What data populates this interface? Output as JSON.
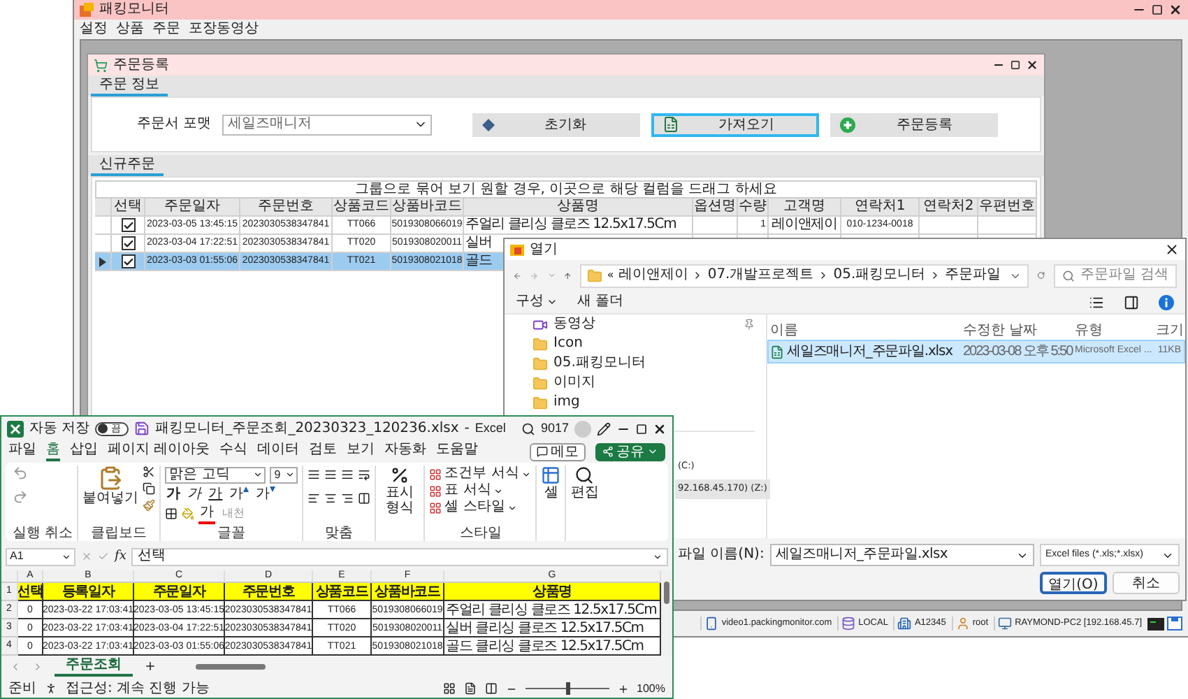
{
  "app": {
    "title": "패킹모니터",
    "menu": [
      "설정",
      "상품",
      "주문",
      "포장동영상"
    ],
    "order_window": {
      "title": "주문등록",
      "tabs": [
        {
          "label": "주문 정보",
          "selected": true
        }
      ],
      "format": {
        "label": "주문서 포맷",
        "value": "세일즈매니저"
      },
      "buttons": [
        {
          "label": "초기화",
          "kind": "reset",
          "focused": false
        },
        {
          "label": "가져오기",
          "kind": "import",
          "focused": true
        },
        {
          "label": "주문등록",
          "kind": "add",
          "focused": false
        }
      ],
      "grid_tabs": [
        {
          "label": "신규주문",
          "selected": true
        }
      ],
      "group_hint": "그룹으로 묶어 보기 원할 경우, 이곳으로 해당 컬럼을 드래그 하세요",
      "check_column": "선택",
      "columns": [
        "주문일자",
        "주문번호",
        "상품코드",
        "상품바코드",
        "상품명",
        "옵션명",
        "수량",
        "고객명",
        "연락처1",
        "연락처2",
        "우편번호"
      ],
      "rows": [
        {
          "selected": false,
          "checked": true,
          "cells": [
            "2023-03-05 13:45:15",
            "2023030538347841",
            "TT066",
            "5019308066019",
            "주얼리 클리싱 클로즈 12.5x17.5Cm",
            null,
            "1",
            "레이앤제이",
            "010-1234-0018"
          ]
        },
        {
          "selected": false,
          "checked": true,
          "cells": [
            "2023-03-04 17:22:51",
            "2023030538347841",
            "TT020",
            "5019308020011",
            "실버"
          ]
        },
        {
          "selected": true,
          "checked": true,
          "cells": [
            "2023-03-03 01:55:06",
            "2023030538347841",
            "TT021",
            "5019308021018",
            "골드"
          ]
        }
      ]
    },
    "status_bar": [
      {
        "kind": "video",
        "text": "video1.packingmonitor.com"
      },
      {
        "kind": "db",
        "text": "LOCAL"
      },
      {
        "kind": "building",
        "text": "A12345"
      },
      {
        "kind": "user",
        "text": "root"
      },
      {
        "kind": "pc",
        "text": "RAYMOND-PC2 [192.168.45.7]"
      }
    ]
  },
  "open_dialog": {
    "title": "열기",
    "overflow": "«",
    "path": [
      "레이앤제이",
      "07.개발프로젝트",
      "05.패킹모니터",
      "주문파일"
    ],
    "search_placeholder": "주문파일 검색",
    "toolbar": {
      "organize": "구성",
      "new_folder": "새 폴더"
    },
    "nav_items": [
      {
        "label": "동영상",
        "kind": "video",
        "pinned": true,
        "selected": false
      },
      {
        "label": "Icon",
        "kind": "folder",
        "pinned": false,
        "selected": false
      },
      {
        "label": "05.패킹모니터",
        "kind": "folder",
        "pinned": false,
        "selected": false
      },
      {
        "label": "이미지",
        "kind": "folder",
        "pinned": false,
        "selected": false
      },
      {
        "label": "img",
        "kind": "folder",
        "pinned": false,
        "selected": false
      },
      {
        "label": "(C:)",
        "kind": "drive",
        "pinned": false,
        "selected": false
      },
      {
        "label": "92.168.45.170) (Z:)",
        "kind": "drive",
        "pinned": false,
        "selected": true
      }
    ],
    "columns": [
      "이름",
      "수정한 날짜",
      "유형",
      "크기"
    ],
    "files": [
      {
        "name": "세일즈매니저_주문파일.xlsx",
        "modified": "2023-03-08 오후 5:50",
        "type": "Microsoft Excel ...",
        "size": "11KB",
        "selected": true
      }
    ],
    "file_name_label": "파일 이름(N):",
    "file_name": "세일즈매니저_주문파일.xlsx",
    "filter": "Excel files (*.xls;*.xlsx)",
    "buttons": [
      {
        "label": "열기(O)",
        "kind": "primary"
      },
      {
        "label": "취소",
        "kind": "secondary"
      }
    ]
  },
  "excel": {
    "autosave_label": "자동 저장",
    "autosave": {
      "on": false,
      "text": "끔"
    },
    "file_name": "패킹모니터_주문조회_20230323_120236.xlsx",
    "separator": "-",
    "app_name": "Excel",
    "user_id": "9017",
    "tabs": [
      {
        "label": "파일",
        "selected": false
      },
      {
        "label": "홈",
        "selected": true
      },
      {
        "label": "삽입",
        "selected": false
      },
      {
        "label": "페이지 레이아웃",
        "selected": false
      },
      {
        "label": "수식",
        "selected": false
      },
      {
        "label": "데이터",
        "selected": false
      },
      {
        "label": "검토",
        "selected": false
      },
      {
        "label": "보기",
        "selected": false
      },
      {
        "label": "자동화",
        "selected": false
      },
      {
        "label": "도움말",
        "selected": false
      }
    ],
    "memo_button": "메모",
    "share_button": "공유",
    "ribbon": {
      "undo_group": "실행 취소",
      "paste": "붙여넣기",
      "clipboard_group": "클립보드",
      "font_name": "맑은 고딕",
      "font_size": "9",
      "font_buttons": [
        {
          "text": "가",
          "kind": "bold"
        },
        {
          "text": "가",
          "kind": "italic"
        },
        {
          "text": "가",
          "kind": "underline"
        },
        {
          "text": "가",
          "kind": "grow"
        },
        {
          "text": "가",
          "kind": "shrink"
        }
      ],
      "font_color": "가",
      "phonetic": "내천",
      "font_group": "글꼴",
      "align_group": "맞춤",
      "number_format": "표시 형식",
      "styles": [
        "조건부 서식",
        "표 서식",
        "셀 스타일"
      ],
      "styles_group": "스타일",
      "cells": "셀",
      "editing": "편집"
    },
    "name_box": "A1",
    "function_label": "fx",
    "formula": "선택",
    "columns": [
      "A",
      "B",
      "C",
      "D",
      "E",
      "F",
      "G"
    ],
    "rows": [
      {
        "number": "1",
        "kind": "header",
        "cells": [
          "선택",
          "등록일자",
          "주문일자",
          "주문번호",
          "상품코드",
          "상품바코드",
          "상품명"
        ]
      },
      {
        "number": "2",
        "kind": "data",
        "cells": [
          "0",
          "2023-03-22 17:03:41",
          "2023-03-05 13:45:15",
          "2023030538347841",
          "TT066",
          "5019308066019",
          "주얼리 클리싱 클로즈 12.5x17.5Cm"
        ]
      },
      {
        "number": "3",
        "kind": "data",
        "cells": [
          "0",
          "2023-03-22 17:03:41",
          "2023-03-04 17:22:51",
          "2023030538347841",
          "TT020",
          "5019308020011",
          "실버 클리싱 클로즈 12.5x17.5Cm"
        ]
      },
      {
        "number": "4",
        "kind": "data",
        "cells": [
          "0",
          "2023-03-22 17:03:41",
          "2023-03-03 01:55:06",
          "2023030538347841",
          "TT021",
          "5019308021018",
          "골드 클리싱 클로즈 12.5x17.5Cm"
        ]
      }
    ],
    "sheet_tabs": [
      {
        "label": "주문조회",
        "selected": true
      }
    ],
    "status": "준비",
    "accessibility": "접근성: 계속 진행 가능",
    "zoom": {
      "level": 0.5,
      "text": "100%"
    }
  }
}
